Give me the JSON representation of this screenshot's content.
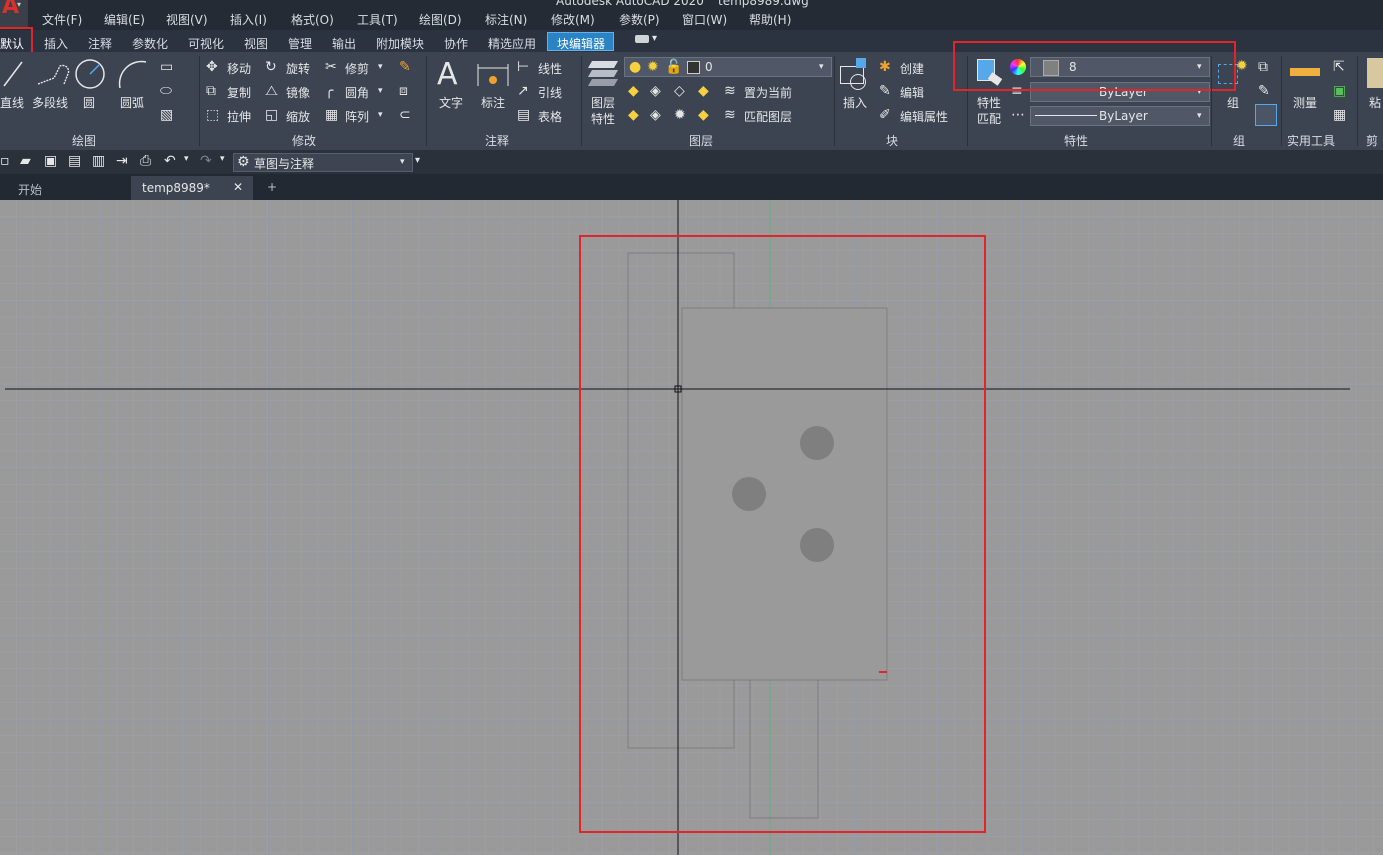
{
  "window": {
    "title_fragment_left": "Autodesk AutoCAD 2020",
    "title_fragment_right": "temp8989.dwg"
  },
  "menu": [
    "文件(F)",
    "编辑(E)",
    "视图(V)",
    "插入(I)",
    "格式(O)",
    "工具(T)",
    "绘图(D)",
    "标注(N)",
    "修改(M)",
    "参数(P)",
    "窗口(W)",
    "帮助(H)"
  ],
  "ribbon_tabs": [
    "默认",
    "插入",
    "注释",
    "参数化",
    "可视化",
    "视图",
    "管理",
    "输出",
    "附加模块",
    "协作",
    "精选应用",
    "块编辑器"
  ],
  "draw_panel": {
    "line": "直线",
    "polyline": "多段线",
    "circle": "圆",
    "arc": "圆弧",
    "title": "绘图"
  },
  "modify_panel": {
    "move": "移动",
    "rotate": "旋转",
    "trim": "修剪",
    "copy": "复制",
    "mirror": "镜像",
    "fillet": "圆角",
    "stretch": "拉伸",
    "scale": "缩放",
    "array": "阵列",
    "title": "修改"
  },
  "annotation_panel": {
    "text": "文字",
    "dimension": "标注",
    "linear": "线性",
    "leader": "引线",
    "table": "表格",
    "title": "注释"
  },
  "layers_panel": {
    "layer_props_line1": "图层",
    "layer_props_line2": "特性",
    "current_layer": "0",
    "set_current": "置为当前",
    "match_layer": "匹配图层",
    "title": "图层"
  },
  "block_panel": {
    "insert": "插入",
    "create": "创建",
    "edit": "编辑",
    "edit_attributes": "编辑属性",
    "title": "块"
  },
  "properties_panel": {
    "match_props_line1": "特性",
    "match_props_line2": "匹配",
    "color_value": "8",
    "lineweight": "ByLayer",
    "linetype": "ByLayer",
    "title": "特性"
  },
  "group_panel": {
    "group": "组",
    "title": "组"
  },
  "utilities_panel": {
    "measure": "测量",
    "title": "实用工具"
  },
  "clipboard_panel": {
    "paste": "粘",
    "title": "剪"
  },
  "quick_access": {
    "workspace": "草图与注释"
  },
  "doc_tabs": {
    "start": "开始",
    "current": "temp8989*",
    "close": "✕",
    "new": "+"
  },
  "colors": {
    "highlight_red": "#e0262a",
    "canvas_bg": "#9a9a9a",
    "ribbon_bg": "#3c4452",
    "active_tab_blue": "#2a83c4"
  }
}
